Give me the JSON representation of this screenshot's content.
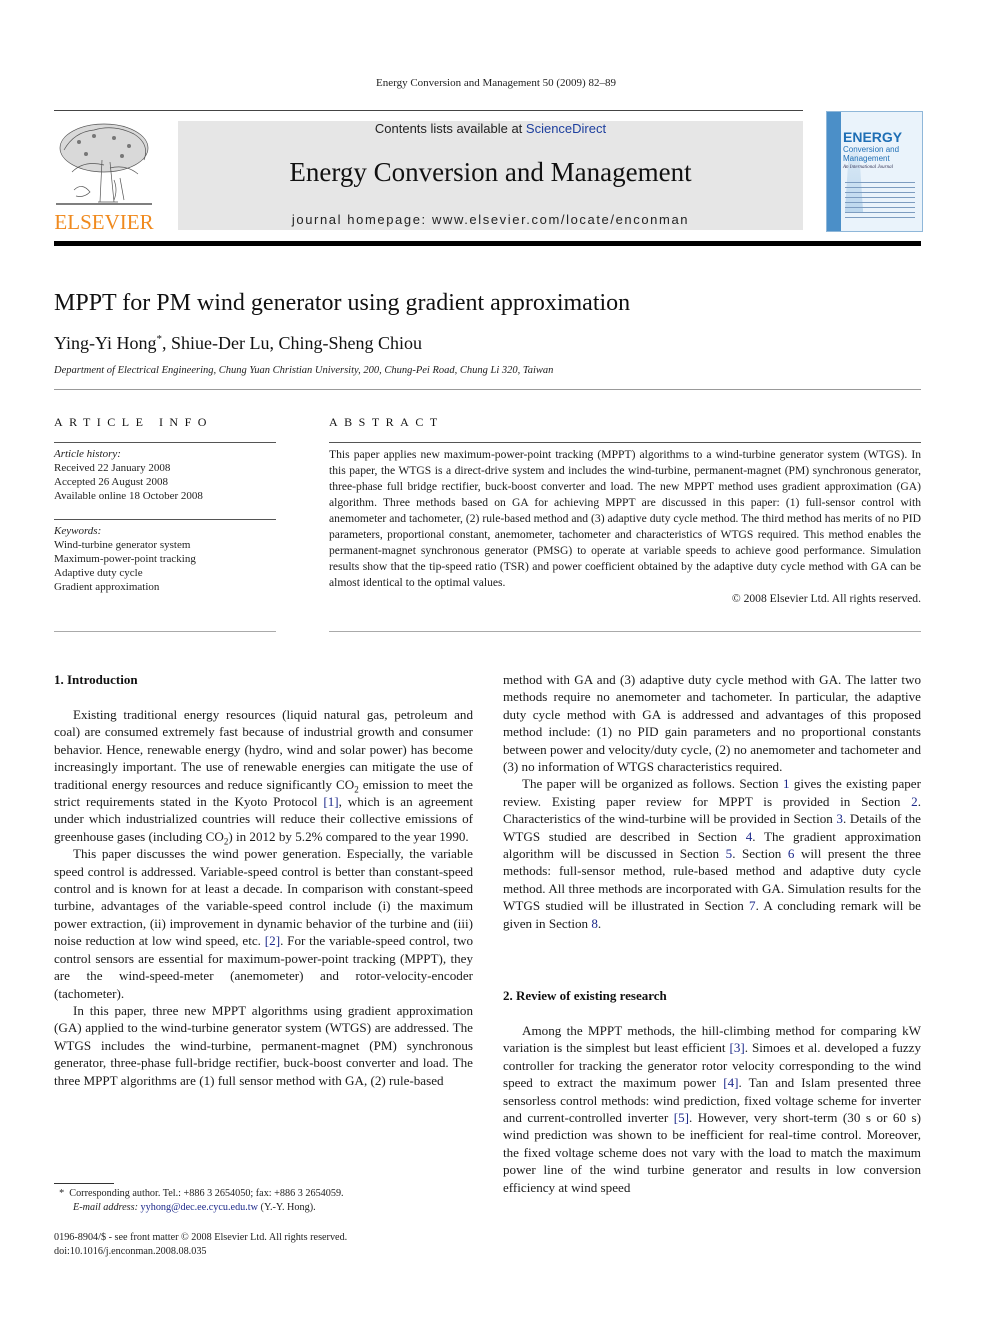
{
  "running_head": "Energy Conversion and Management 50 (2009) 82–89",
  "masthead": {
    "publisher_logo_word": "ELSEVIER",
    "contents_prefix": "Contents lists available at ",
    "contents_link": "ScienceDirect",
    "journal_title": "Energy Conversion and Management",
    "homepage": "journal homepage: www.elsevier.com/locate/enconman",
    "cover": {
      "title_big": "ENERGY",
      "title_small_1": "Conversion and",
      "title_small_2": "Management",
      "subtitle": "An International Journal"
    },
    "colors": {
      "elsevier_orange": "#f08a1e",
      "link_blue": "#1d3f9e",
      "banner_gray": "#e6e6e6",
      "cover_blue": "#1f6fb5"
    }
  },
  "article": {
    "title": "MPPT for PM wind generator using gradient approximation",
    "authors": [
      {
        "name": "Ying-Yi Hong",
        "mark": "*"
      },
      {
        "name": "Shiue-Der Lu",
        "mark": ""
      },
      {
        "name": "Ching-Sheng Chiou",
        "mark": ""
      }
    ],
    "affiliation": "Department of Electrical Engineering, Chung Yuan Christian University, 200, Chung-Pei Road, Chung Li 320, Taiwan"
  },
  "article_info": {
    "heading": "ARTICLE INFO",
    "history_label": "Article history:",
    "history": [
      "Received 22 January 2008",
      "Accepted 26 August 2008",
      "Available online 18 October 2008"
    ],
    "keywords_label": "Keywords:",
    "keywords": [
      "Wind-turbine generator system",
      "Maximum-power-point tracking",
      "Adaptive duty cycle",
      "Gradient approximation"
    ]
  },
  "abstract": {
    "heading": "ABSTRACT",
    "text": "This paper applies new maximum-power-point tracking (MPPT) algorithms to a wind-turbine generator system (WTGS). In this paper, the WTGS is a direct-drive system and includes the wind-turbine, permanent-magnet (PM) synchronous generator, three-phase full bridge rectifier, buck-boost converter and load. The new MPPT method uses gradient approximation (GA) algorithm. Three methods based on GA for achieving MPPT are discussed in this paper: (1) full-sensor control with anemometer and tachometer, (2) rule-based method and (3) adaptive duty cycle method. The third method has merits of no PID parameters, proportional constant, anemometer, tachometer and characteristics of WTGS required. This method enables the permanent-magnet synchronous generator (PMSG) to operate at variable speeds to achieve good performance. Simulation results show that the tip-speed ratio (TSR) and power coefficient obtained by the adaptive duty cycle method with GA can be almost identical to the optimal values.",
    "copyright": "© 2008 Elsevier Ltd. All rights reserved."
  },
  "body": {
    "sec1_heading": "1. Introduction",
    "p1": {
      "a": "Existing traditional energy resources (liquid natural gas, petroleum and coal) are consumed extremely fast because of industrial growth and consumer behavior. Hence, renewable energy (hydro, wind and solar power) has become increasingly important. The use of renewable energies can mitigate the use of traditional energy resources and reduce significantly CO",
      "sub1": "2",
      "b": " emission to meet the strict requirements stated in the Kyoto Protocol ",
      "ref1": "[1]",
      "c": ", which is an agreement under which industrialized countries will reduce their collective emissions of greenhouse gases (including CO",
      "sub2": "2",
      "d": ") in 2012 by 5.2% compared to the year 1990."
    },
    "p2": {
      "a": "This paper discusses the wind power generation. Especially, the variable speed control is addressed. Variable-speed control is better than constant-speed control and is known for at least a decade. In comparison with constant-speed turbine, advantages of the variable-speed control include (i) the maximum power extraction, (ii) improvement in dynamic behavior of the turbine and (iii) noise reduction at low wind speed, etc. ",
      "ref": "[2]",
      "b": ". For the variable-speed control, two control sensors are essential for maximum-power-point tracking (MPPT), they are the wind-speed-meter (anemometer) and rotor-velocity-encoder (tachometer)."
    },
    "p3": "In this paper, three new MPPT algorithms using gradient approximation (GA) applied to the wind-turbine generator system (WTGS) are addressed. The WTGS includes the wind-turbine, permanent-magnet (PM) synchronous generator, three-phase full-bridge rectifier, buck-boost converter and load. The three MPPT algorithms are (1) full sensor method with GA, (2) rule-based",
    "p3_cont": "method with GA and (3) adaptive duty cycle method with GA. The latter two methods require no anemometer and tachometer. In particular, the adaptive duty cycle method with GA is addressed and advantages of this proposed method include: (1) no PID gain parameters and no proportional constants between power and velocity/duty cycle, (2) no anemometer and tachometer and (3) no information of WTGS characteristics required.",
    "p4": {
      "a": "The paper will be organized as follows. Section ",
      "s1": "1",
      "b": " gives the existing paper review. Existing paper review for MPPT is provided in Section ",
      "s2": "2",
      "c": ". Characteristics of the wind-turbine will be provided in Section ",
      "s3": "3",
      "d": ". Details of the WTGS studied are described in Section ",
      "s4": "4",
      "e": ". The gradient approximation algorithm will be discussed in Section ",
      "s5": "5",
      "f": ". Section ",
      "s6": "6",
      "g": " will present the three methods: full-sensor method, rule-based method and adaptive duty cycle method. All three methods are incorporated with GA. Simulation results for the WTGS studied will be illustrated in Section ",
      "s7": "7",
      "h": ". A concluding remark will be given in Section ",
      "s8": "8",
      "i": "."
    },
    "sec2_heading": "2. Review of existing research",
    "p5": {
      "a": "Among the MPPT methods, the hill-climbing method for comparing kW variation is the simplest but least efficient ",
      "r3": "[3]",
      "b": ". Simoes et al. developed a fuzzy controller for tracking the generator rotor velocity corresponding to the wind speed to extract the maximum power ",
      "r4": "[4]",
      "c": ". Tan and Islam presented three sensorless control methods: wind prediction, fixed voltage scheme for inverter and current-controlled inverter ",
      "r5": "[5]",
      "d": ". However, very short-term (30 s or 60 s) wind prediction was shown to be inefficient for real-time control. Moreover, the fixed voltage scheme does not vary with the load to match the maximum power line of the wind turbine generator and results in low conversion efficiency at wind speed"
    }
  },
  "footnote": {
    "mark": "*",
    "corresponding": "Corresponding author. Tel.: +886 3 2654050; fax: +886 3 2654059.",
    "email_label": "E-mail address:",
    "email": "yyhong@dec.ee.cycu.edu.tw",
    "email_suffix": " (Y.-Y. Hong)."
  },
  "bottom": {
    "issn_line": "0196-8904/$ - see front matter © 2008 Elsevier Ltd. All rights reserved.",
    "doi": "doi:10.1016/j.enconman.2008.08.035"
  }
}
